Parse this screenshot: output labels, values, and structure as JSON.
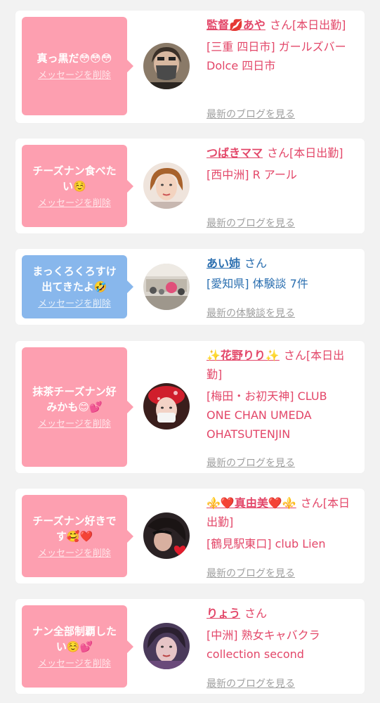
{
  "colors": {
    "pink": "#fd9fb0",
    "blue": "#88b7ec",
    "text_pink": "#e34769",
    "text_blue": "#2b6fb0",
    "link_gray": "#a0a0a0"
  },
  "cards": [
    {
      "message": "真っ黒だ😳😳😳",
      "delete_label": "メッセージを削除",
      "name": "監督💋あや",
      "san": "さん[本日出勤]",
      "location": "[三重 四日市] ガールズバー Dolce 四日市",
      "link": "最新のブログを見る",
      "bubble_color": "pink",
      "avatar_icon": "person-mask-avatar"
    },
    {
      "message": "チーズナン食べたい☺️",
      "delete_label": "メッセージを削除",
      "name": "つばきママ",
      "san": "さん[本日出勤]",
      "location": "[西中洲] R アール",
      "link": "最新のブログを見る",
      "bubble_color": "pink",
      "avatar_icon": "woman-avatar"
    },
    {
      "message": "まっくろくろすけ出てきたよ🤣",
      "delete_label": "メッセージを削除",
      "name": "あい姉",
      "san": "さん",
      "location": "[愛知県] 体験談 7件",
      "link": "最新の体験談を見る",
      "bubble_color": "blue",
      "avatar_icon": "crowd-photo-avatar"
    },
    {
      "message": "抹茶チーズナン好みかも😊💕",
      "delete_label": "メッセージを削除",
      "name": "✨花野りり✨",
      "san": "さん[本日出勤]",
      "location": "[梅田・お初天神] CLUB ONE CHAN UMEDA OHATSUTENJIN",
      "link": "最新のブログを見る",
      "bubble_color": "pink",
      "avatar_icon": "woman-red-hat-avatar"
    },
    {
      "message": "チーズナン好きです🥰❤️",
      "delete_label": "メッセージを削除",
      "name": "⚜️❤️真由美❤️⚜️",
      "san": "さん[本日出勤]",
      "location": "[鶴見駅東口] club Lien",
      "link": "最新のブログを見る",
      "bubble_color": "pink",
      "avatar_icon": "dark-portrait-heart-avatar"
    },
    {
      "message": "ナン全部制覇したい☺️💕",
      "delete_label": "メッセージを削除",
      "name": "りょう",
      "san": "さん",
      "location": "[中洲] 熟女キャバクラ collection second",
      "link": "最新のブログを見る",
      "bubble_color": "pink",
      "avatar_icon": "woman-purple-avatar"
    }
  ]
}
